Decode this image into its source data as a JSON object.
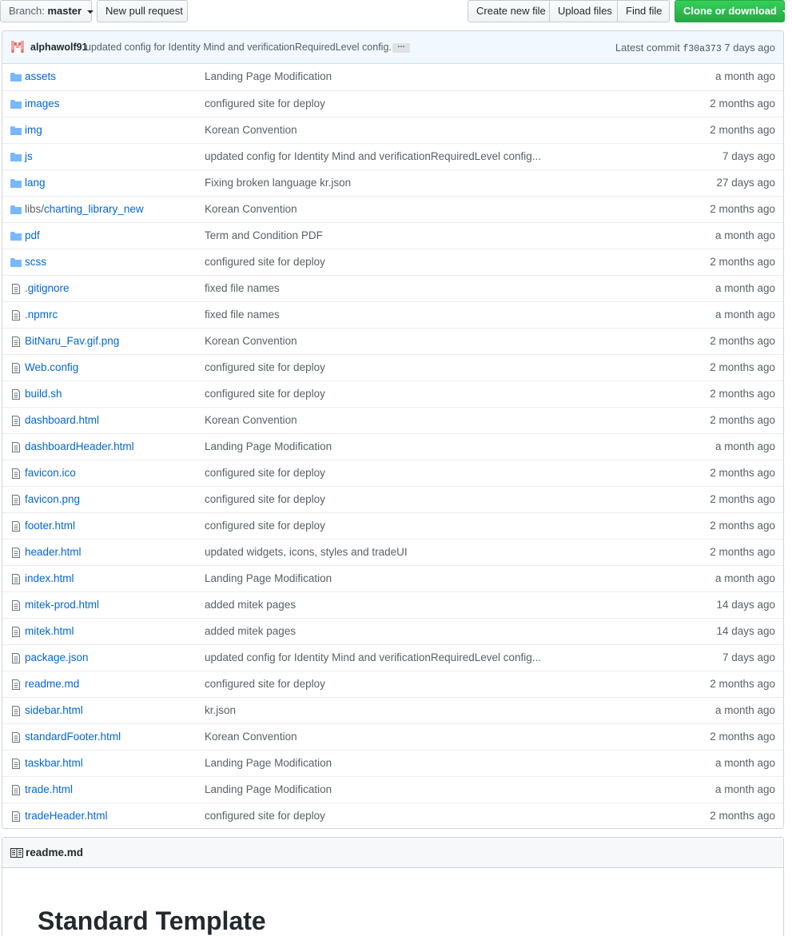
{
  "toolbar": {
    "branch_prefix": "Branch:",
    "branch_name": "master",
    "new_pull_request": "New pull request",
    "create_new_file": "Create new file",
    "upload_files": "Upload files",
    "find_file": "Find file",
    "clone_or_download": "Clone or download"
  },
  "commit": {
    "author": "alphawolf91",
    "message": "updated config for Identity Mind and verificationRequiredLevel config...",
    "ellipsis": "…",
    "latest_label": "Latest commit",
    "sha": "f30a373",
    "age": "7 days ago"
  },
  "files": [
    {
      "type": "dir",
      "name": "assets",
      "message": "Landing Page Modification",
      "age": "a month ago"
    },
    {
      "type": "dir",
      "name": "images",
      "message": "configured site for deploy",
      "age": "2 months ago"
    },
    {
      "type": "dir",
      "name": "img",
      "message": "Korean Convention",
      "age": "2 months ago"
    },
    {
      "type": "dir",
      "name": "js",
      "message": "updated config for Identity Mind and verificationRequiredLevel config...",
      "age": "7 days ago"
    },
    {
      "type": "dir",
      "name": "lang",
      "message": "Fixing broken language kr.json",
      "age": "27 days ago"
    },
    {
      "type": "dir",
      "prefix": "libs/",
      "name": "charting_library_new",
      "message": "Korean Convention",
      "age": "2 months ago"
    },
    {
      "type": "dir",
      "name": "pdf",
      "message": "Term and Condition PDF",
      "age": "a month ago"
    },
    {
      "type": "dir",
      "name": "scss",
      "message": "configured site for deploy",
      "age": "2 months ago"
    },
    {
      "type": "file",
      "name": ".gitignore",
      "message": "fixed file names",
      "age": "a month ago"
    },
    {
      "type": "file",
      "name": ".npmrc",
      "message": "fixed file names",
      "age": "a month ago"
    },
    {
      "type": "file",
      "name": "BitNaru_Fav.gif.png",
      "message": "Korean Convention",
      "age": "2 months ago"
    },
    {
      "type": "file",
      "name": "Web.config",
      "message": "configured site for deploy",
      "age": "2 months ago"
    },
    {
      "type": "file",
      "name": "build.sh",
      "message": "configured site for deploy",
      "age": "2 months ago"
    },
    {
      "type": "file",
      "name": "dashboard.html",
      "message": "Korean Convention",
      "age": "2 months ago"
    },
    {
      "type": "file",
      "name": "dashboardHeader.html",
      "message": "Landing Page Modification",
      "age": "a month ago"
    },
    {
      "type": "file",
      "name": "favicon.ico",
      "message": "configured site for deploy",
      "age": "2 months ago"
    },
    {
      "type": "file",
      "name": "favicon.png",
      "message": "configured site for deploy",
      "age": "2 months ago"
    },
    {
      "type": "file",
      "name": "footer.html",
      "message": "configured site for deploy",
      "age": "2 months ago"
    },
    {
      "type": "file",
      "name": "header.html",
      "message": "updated widgets, icons, styles and tradeUI",
      "age": "2 months ago"
    },
    {
      "type": "file",
      "name": "index.html",
      "message": "Landing Page Modification",
      "age": "a month ago"
    },
    {
      "type": "file",
      "name": "mitek-prod.html",
      "message": "added mitek pages",
      "age": "14 days ago"
    },
    {
      "type": "file",
      "name": "mitek.html",
      "message": "added mitek pages",
      "age": "14 days ago"
    },
    {
      "type": "file",
      "name": "package.json",
      "message": "updated config for Identity Mind and verificationRequiredLevel config...",
      "age": "7 days ago"
    },
    {
      "type": "file",
      "name": "readme.md",
      "message": "configured site for deploy",
      "age": "2 months ago"
    },
    {
      "type": "file",
      "name": "sidebar.html",
      "message": "kr.json",
      "age": "a month ago"
    },
    {
      "type": "file",
      "name": "standardFooter.html",
      "message": "Korean Convention",
      "age": "2 months ago"
    },
    {
      "type": "file",
      "name": "taskbar.html",
      "message": "Landing Page Modification",
      "age": "a month ago"
    },
    {
      "type": "file",
      "name": "trade.html",
      "message": "Landing Page Modification",
      "age": "a month ago"
    },
    {
      "type": "file",
      "name": "tradeHeader.html",
      "message": "configured site for deploy",
      "age": "2 months ago"
    }
  ],
  "readme": {
    "filename": "readme.md",
    "heading": "Standard Template"
  },
  "colors": {
    "link": "#0366d6",
    "muted": "#586069",
    "folder": "#79b8ff",
    "green": "#28a745"
  }
}
